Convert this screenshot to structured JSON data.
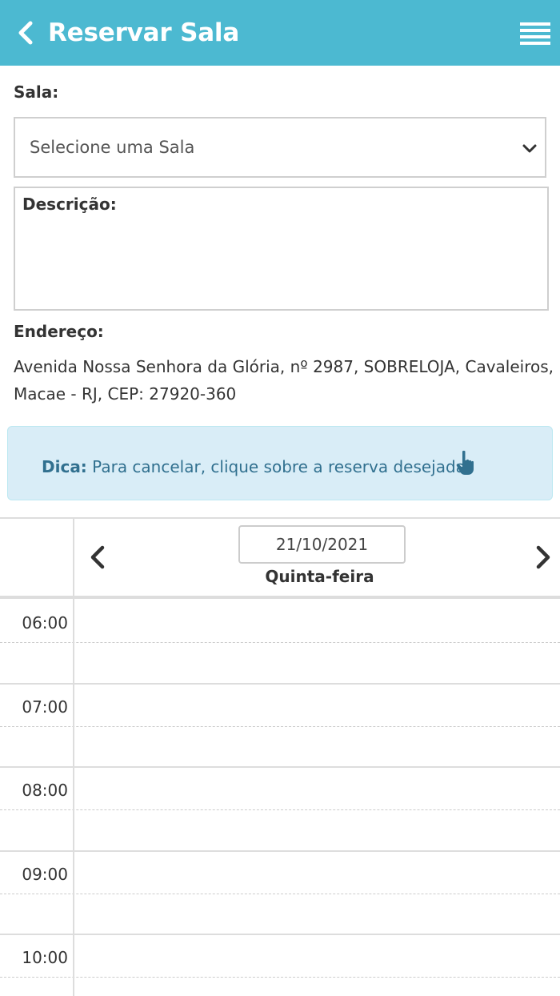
{
  "header": {
    "title": "Reservar Sala",
    "back_icon": "chevron-left-icon",
    "menu_icon": "hamburger-menu-icon",
    "background": "#4cb9d1"
  },
  "form": {
    "room_label": "Sala:",
    "room_select_value": "Selecione uma Sala",
    "description_label": "Descrição:",
    "address_label": "Endereço:",
    "address_value": "Avenida Nossa Senhora da Glória, nº 2987, SOBRELOJA, Cavaleiros, Macae - RJ, CEP: 27920-360"
  },
  "tip": {
    "bold": "Dica:",
    "text": "Para cancelar, clique sobre a reserva desejada",
    "icon": "pointing-hand-icon",
    "color": "#31708f",
    "background": "#d9edf7"
  },
  "calendar": {
    "date": "21/10/2021",
    "weekday": "Quinta-feira",
    "prev_icon": "chevron-left-icon",
    "next_icon": "chevron-right-icon",
    "slots": [
      "06:00",
      "07:00",
      "08:00",
      "09:00",
      "10:00"
    ]
  }
}
